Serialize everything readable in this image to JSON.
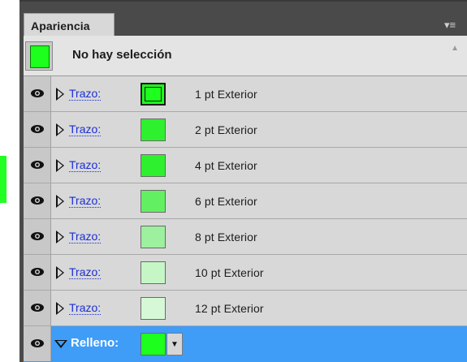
{
  "panel": {
    "tab_label": "Apariencia",
    "menu_icon": "panel-menu-icon"
  },
  "header": {
    "title": "No hay selección",
    "swatch_color": "#1dff1d"
  },
  "strokes": [
    {
      "label": "Trazo:",
      "value": "1 pt  Exterior",
      "color": "#1dff1d",
      "outlined": true
    },
    {
      "label": "Trazo:",
      "value": "2 pt  Exterior",
      "color": "#2ef02e",
      "outlined": false
    },
    {
      "label": "Trazo:",
      "value": "4 pt  Exterior",
      "color": "#2ef02e",
      "outlined": false
    },
    {
      "label": "Trazo:",
      "value": "6 pt  Exterior",
      "color": "#62ef62",
      "outlined": false
    },
    {
      "label": "Trazo:",
      "value": "8 pt  Exterior",
      "color": "#9df09d",
      "outlined": false
    },
    {
      "label": "Trazo:",
      "value": "10 pt  Exterior",
      "color": "#c6f6c6",
      "outlined": false
    },
    {
      "label": "Trazo:",
      "value": "12 pt  Exterior",
      "color": "#d6f8d6",
      "outlined": false
    }
  ],
  "fill": {
    "label": "Relleno:",
    "color": "#1dff1d"
  },
  "colors": {
    "selection": "#3f9cf7",
    "link": "#1a2ed6"
  }
}
